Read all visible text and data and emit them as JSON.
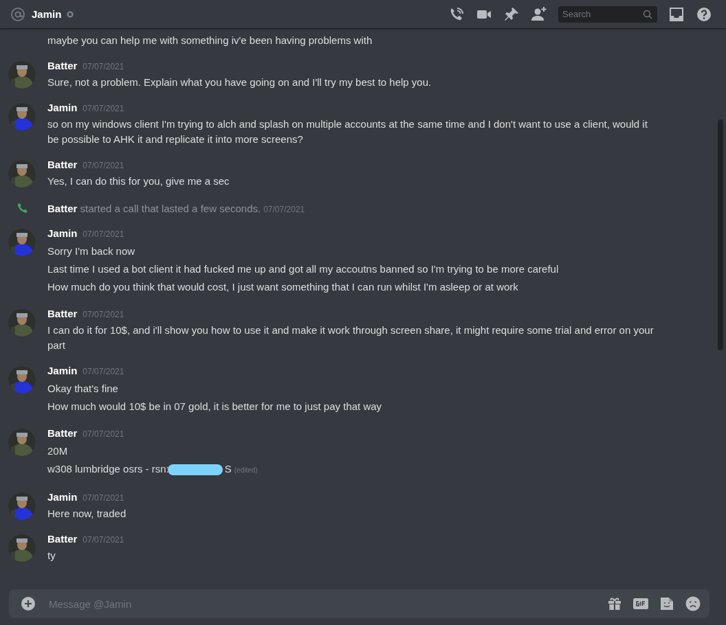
{
  "header": {
    "title": "Jamin",
    "search": {
      "placeholder": "Search"
    }
  },
  "messages": [
    {
      "kind": "continuation",
      "lines": [
        {
          "text": "maybe you can help me with something iv'e been having problems with"
        }
      ]
    },
    {
      "kind": "group",
      "author": "Batter",
      "avatar": {
        "kind": "picture",
        "color": "#4d5a3e"
      },
      "time": "07/07/2021",
      "lines": [
        {
          "text": "Sure, not a problem. Explain what you have going on and I'll try my best to help you."
        }
      ]
    },
    {
      "kind": "group",
      "author": "Jamin",
      "avatar": {
        "kind": "picture",
        "color": "#2432d8"
      },
      "time": "07/07/2021",
      "lines": [
        {
          "text": "so on my windows client I'm trying to alch and splash on multiple accounts at the same time and I don't want to use a client, would it be possible to AHK it and replicate it into more screens?"
        }
      ]
    },
    {
      "kind": "group",
      "author": "Batter",
      "avatar": {
        "kind": "picture",
        "color": "#4d5a3e"
      },
      "time": "07/07/2021",
      "lines": [
        {
          "text": "Yes, I can do this for you, give me a sec"
        }
      ]
    },
    {
      "kind": "call",
      "author": "Batter",
      "text": "started a call that lasted a few seconds.",
      "time": "07/07/2021"
    },
    {
      "kind": "group",
      "author": "Jamin",
      "avatar": {
        "kind": "picture",
        "color": "#2432d8"
      },
      "time": "07/07/2021",
      "lines": [
        {
          "text": "Sorry I'm back now"
        },
        {
          "text": "Last time I used a bot client it had fucked me up and got all my accoutns banned so I'm trying to be more careful"
        },
        {
          "text": "How much do you think that would cost, I just want something that I can run whilst I'm asleep or at work"
        }
      ]
    },
    {
      "kind": "group",
      "author": "Batter",
      "avatar": {
        "kind": "picture",
        "color": "#4d5a3e"
      },
      "time": "07/07/2021",
      "lines": [
        {
          "text": "I can do it for 10$, and i'll show you how to use it and make it work through screen share, it might require some trial and error on your part"
        }
      ]
    },
    {
      "kind": "group",
      "author": "Jamin",
      "avatar": {
        "kind": "picture",
        "color": "#2432d8"
      },
      "time": "07/07/2021",
      "lines": [
        {
          "text": "Okay that's fine"
        },
        {
          "text": "How much would 10$ be in 07 gold, it is better for me to just pay that way"
        }
      ]
    },
    {
      "kind": "group",
      "author": "Batter",
      "avatar": {
        "kind": "picture",
        "color": "#4d5a3e"
      },
      "time": "07/07/2021",
      "lines": [
        {
          "text": "20M"
        },
        {
          "text": "w308 lumbridge osrs - rsn:",
          "redacted": true,
          "tail": "S",
          "edited": "(edited)"
        }
      ]
    },
    {
      "kind": "group",
      "author": "Jamin",
      "avatar": {
        "kind": "picture",
        "color": "#2432d8"
      },
      "time": "07/07/2021",
      "lines": [
        {
          "text": "Here now, traded"
        }
      ]
    },
    {
      "kind": "group",
      "author": "Batter",
      "avatar": {
        "kind": "picture",
        "color": "#4d5a3e"
      },
      "time": "07/07/2021",
      "lines": [
        {
          "text": "ty"
        }
      ]
    }
  ],
  "composer": {
    "placeholder": "Message @Jamin"
  }
}
